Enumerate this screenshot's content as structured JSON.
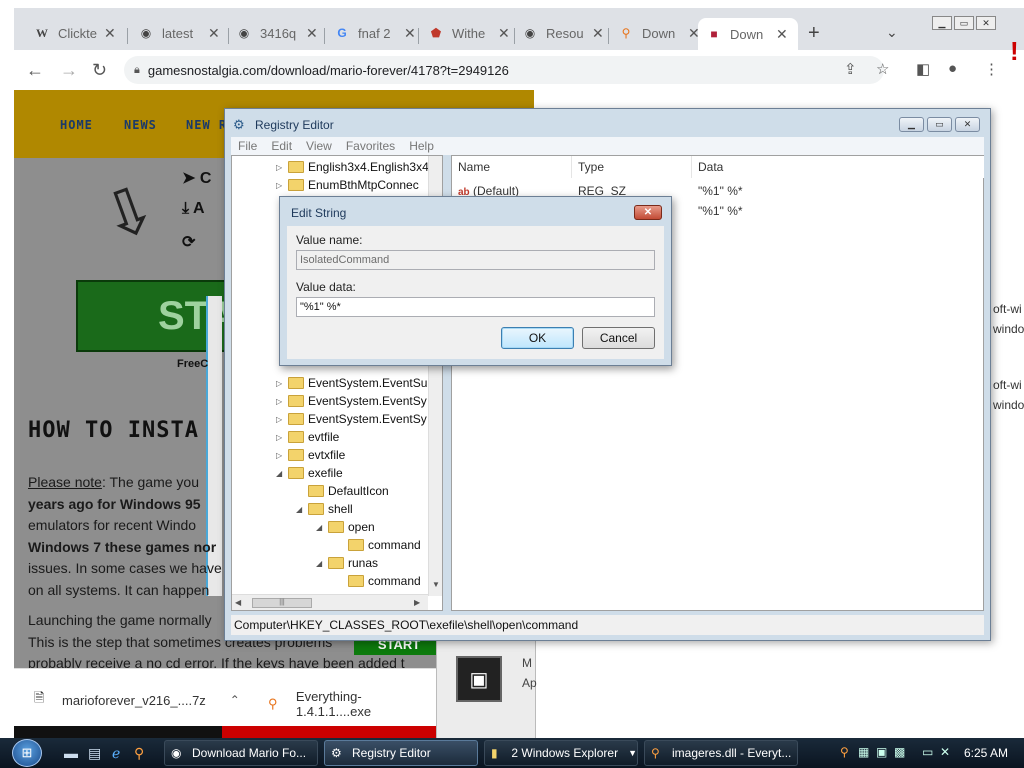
{
  "browser": {
    "tabs": [
      {
        "label": "Clickte",
        "icon": "W"
      },
      {
        "label": "latest",
        "icon": "◉"
      },
      {
        "label": "3416q",
        "icon": "◉"
      },
      {
        "label": "fnaf 2",
        "icon": "G"
      },
      {
        "label": "Withe",
        "icon": "⬟"
      },
      {
        "label": "Resou",
        "icon": "◉"
      },
      {
        "label": "Down",
        "icon": "⚲"
      },
      {
        "label": "Down",
        "icon": "■"
      }
    ],
    "url": "gamesnostalgia.com/download/mario-forever/4178?t=2949126"
  },
  "site": {
    "nav": [
      "HOME",
      "NEWS",
      "NEW R"
    ],
    "side_labels": [
      "C",
      "A"
    ],
    "start_label": "STA",
    "free_label": "FreeC",
    "howto_title": "HOW TO INSTA",
    "para1_note": "Please note",
    "para1_lines": [
      ": The game you",
      "years ago for Windows 95",
      "emulators for recent Windo",
      "Windows 7 these games nor",
      "issues. In some cases we have",
      "on all systems. It can happen"
    ],
    "para2_lines": [
      "Launching the game normally",
      "This is the step that sometimes creates problems",
      "probably receive a no cd error. If the keys have been added t"
    ],
    "start_small": "START"
  },
  "downloads": [
    {
      "name": "marioforever_v216_....7z"
    },
    {
      "name": "Everything-1.4.1.1....exe"
    }
  ],
  "behind": {
    "right_texts": [
      "oft-wi",
      "windo",
      "oft-wi",
      "windo"
    ],
    "bottom_texts": [
      "M",
      "Ap"
    ],
    "red_icon": "!"
  },
  "regedit": {
    "title": "Registry Editor",
    "menu": [
      "File",
      "Edit",
      "View",
      "Favorites",
      "Help"
    ],
    "tree": [
      {
        "label": "English3x4.English3x4",
        "indent": 0,
        "exp": "▷"
      },
      {
        "label": "EnumBthMtpConnec",
        "indent": 0,
        "exp": "▷"
      },
      {
        "label": "EventSystem.EventSu",
        "indent": 0,
        "exp": "▷"
      },
      {
        "label": "EventSystem.EventSy",
        "indent": 0,
        "exp": "▷"
      },
      {
        "label": "EventSystem.EventSy",
        "indent": 0,
        "exp": "▷"
      },
      {
        "label": "evtfile",
        "indent": 0,
        "exp": "▷"
      },
      {
        "label": "evtxfile",
        "indent": 0,
        "exp": "▷"
      },
      {
        "label": "exefile",
        "indent": 0,
        "exp": "◢"
      },
      {
        "label": "DefaultIcon",
        "indent": 1,
        "exp": ""
      },
      {
        "label": "shell",
        "indent": 1,
        "exp": "◢"
      },
      {
        "label": "open",
        "indent": 2,
        "exp": "◢"
      },
      {
        "label": "command",
        "indent": 3,
        "exp": ""
      },
      {
        "label": "runas",
        "indent": 2,
        "exp": "◢"
      },
      {
        "label": "command",
        "indent": 3,
        "exp": ""
      }
    ],
    "columns": [
      "Name",
      "Type",
      "Data"
    ],
    "values": [
      {
        "name": "(Default)",
        "type": "REG_SZ",
        "data": "\"%1\" %*"
      },
      {
        "name": "",
        "type": "",
        "data": "\"%1\" %*"
      }
    ],
    "status_path": "Computer\\HKEY_CLASSES_ROOT\\exefile\\shell\\open\\command"
  },
  "dialog": {
    "title": "Edit String",
    "value_name_label": "Value name:",
    "value_name": "IsolatedCommand",
    "value_data_label": "Value data:",
    "value_data": "\"%1\" %*",
    "ok": "OK",
    "cancel": "Cancel",
    "close_glyph": "✕"
  },
  "taskbar": {
    "tasks": [
      {
        "label": "Download Mario Fo...",
        "icon": "◉"
      },
      {
        "label": "Registry Editor",
        "icon": "⚙"
      },
      {
        "label": "2 Windows Explorer",
        "icon": "▮"
      },
      {
        "label": "imageres.dll - Everyt...",
        "icon": "⚲"
      }
    ],
    "clock": "6:25 AM"
  }
}
